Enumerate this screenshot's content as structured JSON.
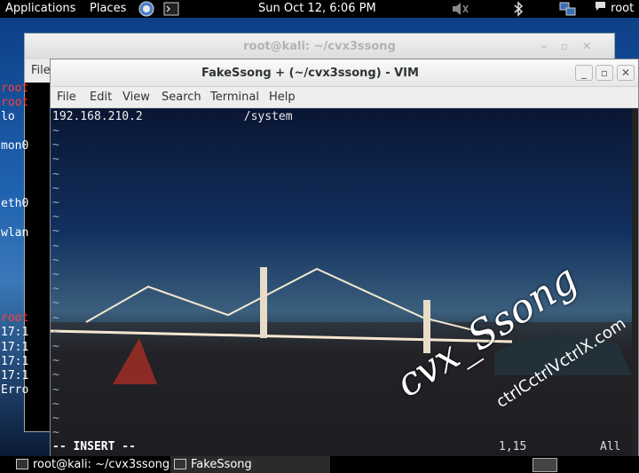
{
  "top_panel": {
    "applications_label": "Applications",
    "places_label": "Places",
    "clock": "Sun Oct 12,  6:06 PM",
    "user_label": "root",
    "icons": {
      "browser": "browser-icon",
      "terminal": "terminal-icon",
      "volume": "volume-muted-icon",
      "bluetooth": "bluetooth-icon",
      "network": "network-icon",
      "user": "speech-bubble-icon"
    }
  },
  "back_window": {
    "title": "root@kali: ~/cvx3ssong",
    "menu_first_label": "File",
    "lines": [
      {
        "text": "root",
        "color": "#ff3b3b"
      },
      {
        "text": "root",
        "color": "#ff3b3b"
      },
      {
        "text": "lo",
        "color": "#ffffff"
      },
      {
        "text": "mon0",
        "color": "#ffffff"
      },
      {
        "text": "eth0",
        "color": "#ffffff"
      },
      {
        "text": "wlan",
        "color": "#ffffff"
      },
      {
        "text": "root",
        "color": "#ff3b3b"
      },
      {
        "text": "17:1",
        "color": "#ffffff"
      },
      {
        "text": "17:1",
        "color": "#ffffff"
      },
      {
        "text": "17:1",
        "color": "#ffffff"
      },
      {
        "text": "17:1",
        "color": "#ffffff"
      },
      {
        "text": "Erro",
        "color": "#ffffff"
      }
    ]
  },
  "vim_window": {
    "title": "FakeSsong + (~/cvx3ssong) - VIM",
    "menus": [
      "File",
      "Edit",
      "View",
      "Search",
      "Terminal",
      "Help"
    ],
    "line1_ip": "192.168.210.2",
    "line1_suffix": "/system",
    "tilde": "~",
    "mode": "-- INSERT --",
    "cursor_position": "1,15",
    "scroll_position": "All",
    "watermark": "cvx_Ssong",
    "watermark_url": "ctrlCctrlVctrlX.com"
  },
  "taskbar": {
    "items": [
      {
        "label": "root@kali: ~/cvx3ssong"
      },
      {
        "label": "FakeSsong"
      }
    ]
  },
  "colors": {
    "panel_bg": "#000000",
    "vim_text": "#e8e8e8",
    "prompt_red": "#ff3b3b"
  }
}
